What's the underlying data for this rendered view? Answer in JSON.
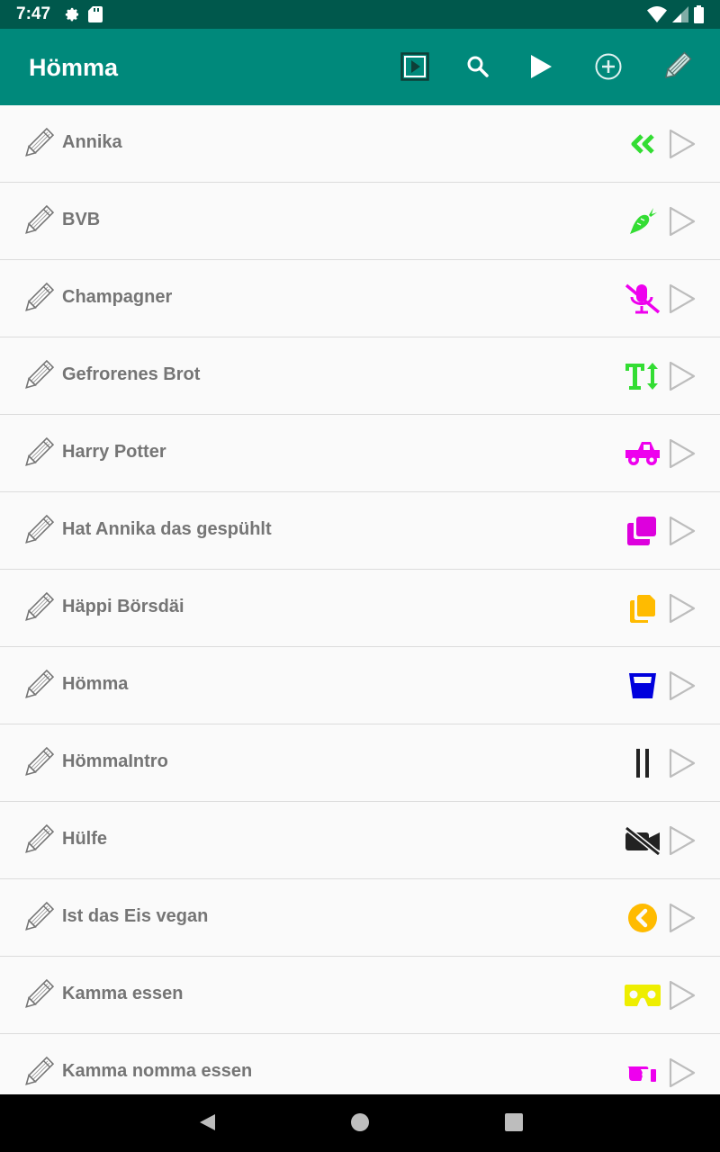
{
  "status_bar": {
    "time": "7:47",
    "left_icons": [
      "gear-icon",
      "sd-card-icon"
    ],
    "right_icons": [
      "wifi-icon",
      "signal-icon",
      "battery-icon"
    ]
  },
  "app_bar": {
    "title": "Hömma",
    "actions": [
      "slideshow-icon",
      "search-icon",
      "play-icon",
      "add-circle-icon",
      "pencil-icon"
    ],
    "colors": {
      "status_bg": "#00584c",
      "bar_bg": "#00897b"
    }
  },
  "items": [
    {
      "label": "Annika",
      "icon": "double-chevron-left-icon",
      "icon_color": "#33dd33"
    },
    {
      "label": "BVB",
      "icon": "carrot-icon",
      "icon_color": "#33dd33"
    },
    {
      "label": "Champagner",
      "icon": "mic-off-icon",
      "icon_color": "#ee00ee"
    },
    {
      "label": "Gefrorenes Brot",
      "icon": "text-height-icon",
      "icon_color": "#33dd33"
    },
    {
      "label": "Harry Potter",
      "icon": "truck-pickup-icon",
      "icon_color": "#ee00ee"
    },
    {
      "label": "Hat Annika das gespühlt",
      "icon": "clone-icon",
      "icon_color": "#dd00dd"
    },
    {
      "label": "Häppi Börsdäi",
      "icon": "copy-icon",
      "icon_color": "#ffbb00"
    },
    {
      "label": "Hömma",
      "icon": "glass-icon",
      "icon_color": "#0000dd"
    },
    {
      "label": "HömmaIntro",
      "icon": "pause-icon",
      "icon_color": "#222222"
    },
    {
      "label": "Hülfe",
      "icon": "video-off-icon",
      "icon_color": "#222222"
    },
    {
      "label": "Ist das Eis vegan",
      "icon": "chevron-circle-left-icon",
      "icon_color": "#ffbb00"
    },
    {
      "label": "Kamma essen",
      "icon": "vr-cardboard-icon",
      "icon_color": "#eeee00"
    },
    {
      "label": "Kamma nomma essen",
      "icon": "hand-point-right-icon",
      "icon_color": "#ee00ee"
    }
  ],
  "nav_bar": [
    "back-icon",
    "home-icon",
    "recents-icon"
  ]
}
